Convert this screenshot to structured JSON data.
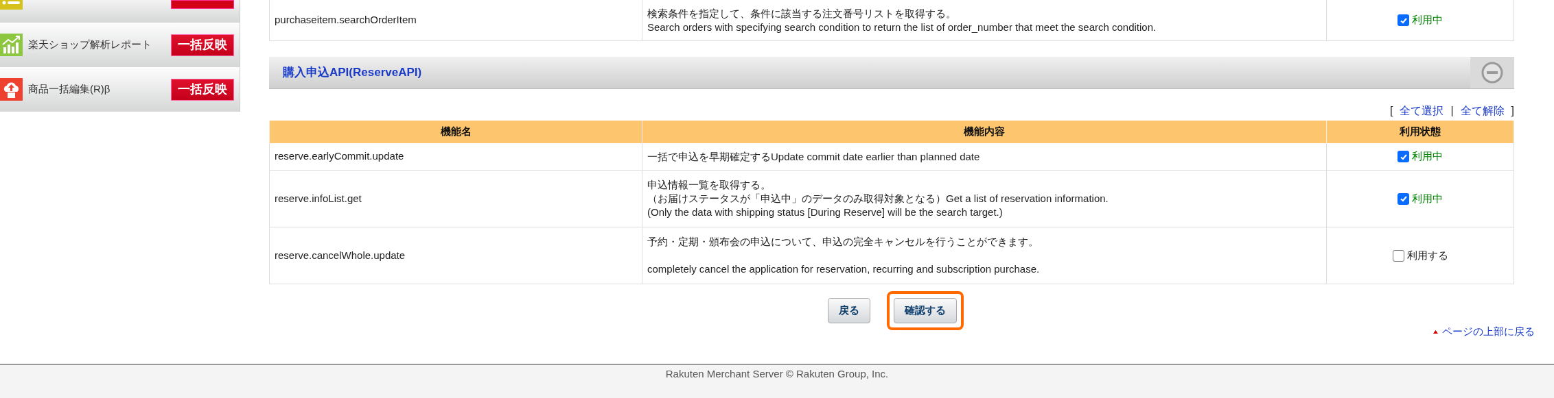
{
  "sidebar": {
    "items": [
      {
        "kind": "cut"
      },
      {
        "kind": "full",
        "label": "楽天ショップ解析レポート",
        "button": "一括反映"
      },
      {
        "kind": "full",
        "label": "商品一括編集(R)β",
        "button": "一括反映"
      }
    ]
  },
  "previous_table": {
    "rows": [
      {
        "name": "purchaseitem.searchOrderItem",
        "description": [
          "検索条件を指定して、条件に該当する注文番号リストを取得する。",
          "Search orders with specifying search condition to return the list of order_number that meet the search condition."
        ],
        "status": "利用中",
        "checked": true
      }
    ]
  },
  "section": {
    "title": "購入申込API(ReserveAPI)",
    "expanded": true,
    "select_links": {
      "open": "[",
      "select_all": "全て選択",
      "separator": "|",
      "clear_all": "全て解除",
      "close": "]"
    },
    "columns": [
      "機能名",
      "機能内容",
      "利用状態"
    ],
    "rows": [
      {
        "name": "reserve.earlyCommit.update",
        "description": [
          "一括で申込を早期確定するUpdate commit date earlier than planned date"
        ],
        "status": "利用中",
        "checked": true
      },
      {
        "name": "reserve.infoList.get",
        "description": [
          "申込情報一覧を取得する。",
          "（お届けステータスが「申込中」のデータのみ取得対象となる）Get a list of reservation information.",
          "(Only the data with shipping status [During Reserve] will be the search target.)"
        ],
        "status": "利用中",
        "checked": true
      },
      {
        "name": "reserve.cancelWhole.update",
        "description": [
          "予約・定期・頒布会の申込について、申込の完全キャンセルを行うことができます。",
          "completely cancel the application for reservation, recurring and subscription purchase."
        ],
        "status": "利用する",
        "checked": false,
        "paragraph_gap": true
      }
    ]
  },
  "buttons": [
    {
      "label": "戻る",
      "highlighted": false
    },
    {
      "label": "確認する",
      "highlighted": true
    }
  ],
  "page_top_link": "ページの上部に戻る",
  "footer": "Rakuten Merchant Server © Rakuten Group, Inc."
}
